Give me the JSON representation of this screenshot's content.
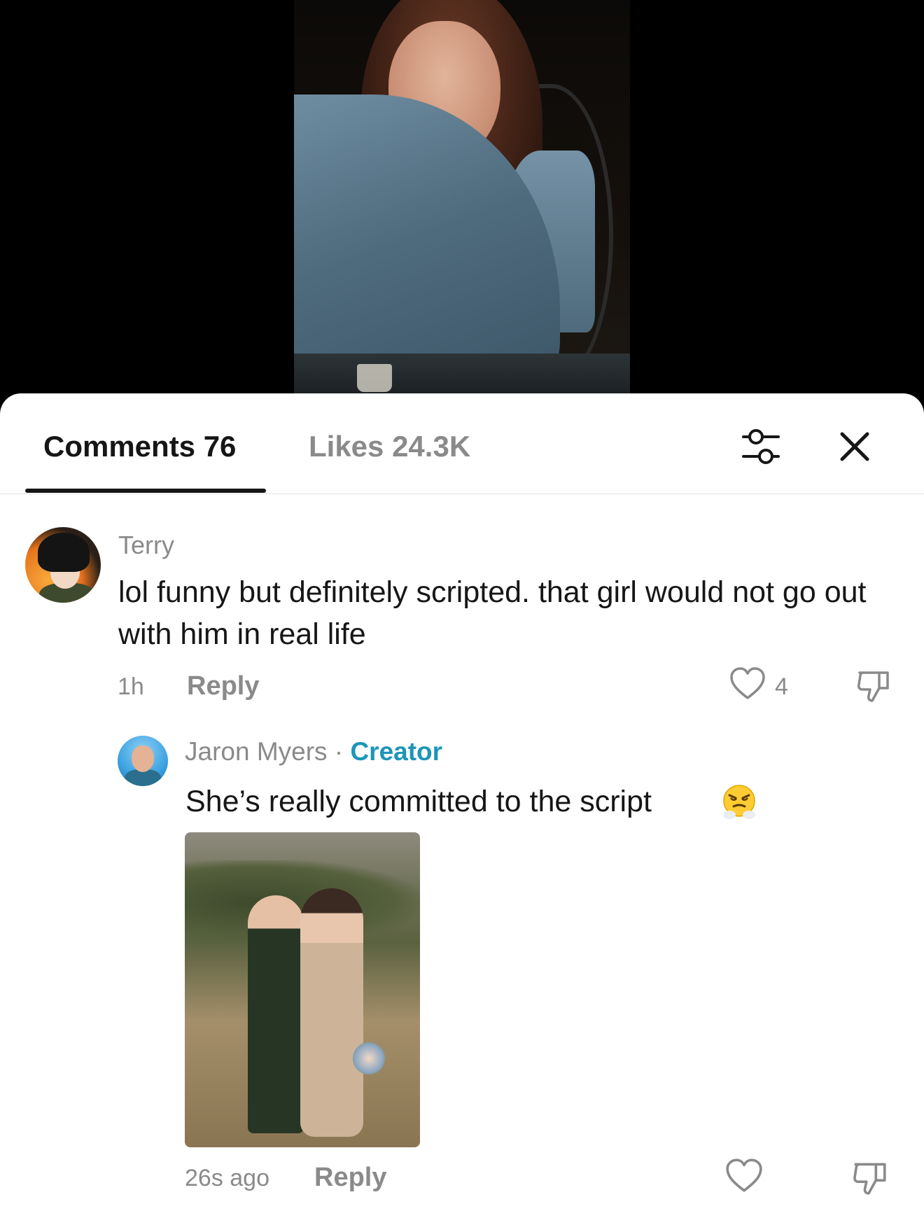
{
  "tabs": {
    "comments_label": "Comments 76",
    "likes_label": "Likes 24.3K"
  },
  "comments": [
    {
      "username": "Terry",
      "text": "lol funny but definitely scripted. that girl would not go out with him in real life",
      "time": "1h",
      "reply_label": "Reply",
      "like_count": "4"
    }
  ],
  "reply": {
    "username": "Jaron Myers",
    "separator": "·",
    "badge": "Creator",
    "text": "She’s really committed to the script",
    "emoji": "face-with-steam-from-nose",
    "time": "26s ago",
    "reply_label": "Reply"
  },
  "icons": {
    "filter": "sliders-icon",
    "close": "close-icon",
    "like": "heart-outline-icon",
    "dislike": "thumbs-down-icon"
  },
  "colors": {
    "accent_creator": "#1d95b8",
    "text_primary": "#161616",
    "text_secondary": "#8a8a8a"
  }
}
